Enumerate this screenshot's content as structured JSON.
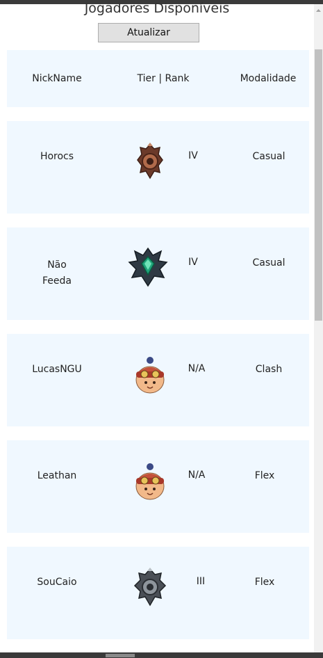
{
  "page": {
    "title": "Jogadores Disponíveis",
    "refresh_label": "Atualizar"
  },
  "table": {
    "headers": {
      "nickname": "NickName",
      "tier_rank": "Tier | Rank",
      "mode": "Modalidade"
    },
    "rows": [
      {
        "nickname": "Horocs",
        "rank": "IV",
        "mode": "Casual",
        "emblem": "bronze-emblem-icon"
      },
      {
        "nickname": "Não\nFeeda",
        "rank": "IV",
        "mode": "Casual",
        "emblem": "emerald-emblem-icon"
      },
      {
        "nickname": "LucasNGU",
        "rank": "N/A",
        "mode": "Clash",
        "emblem": "teemo-icon"
      },
      {
        "nickname": "Leathan",
        "rank": "N/A",
        "mode": "Flex",
        "emblem": "teemo-icon"
      },
      {
        "nickname": "SouCaio",
        "rank": "III",
        "mode": "Flex",
        "emblem": "iron-emblem-icon"
      }
    ]
  },
  "colors": {
    "card_background": "#f0f8ff",
    "button_background": "#e1e1e1"
  }
}
